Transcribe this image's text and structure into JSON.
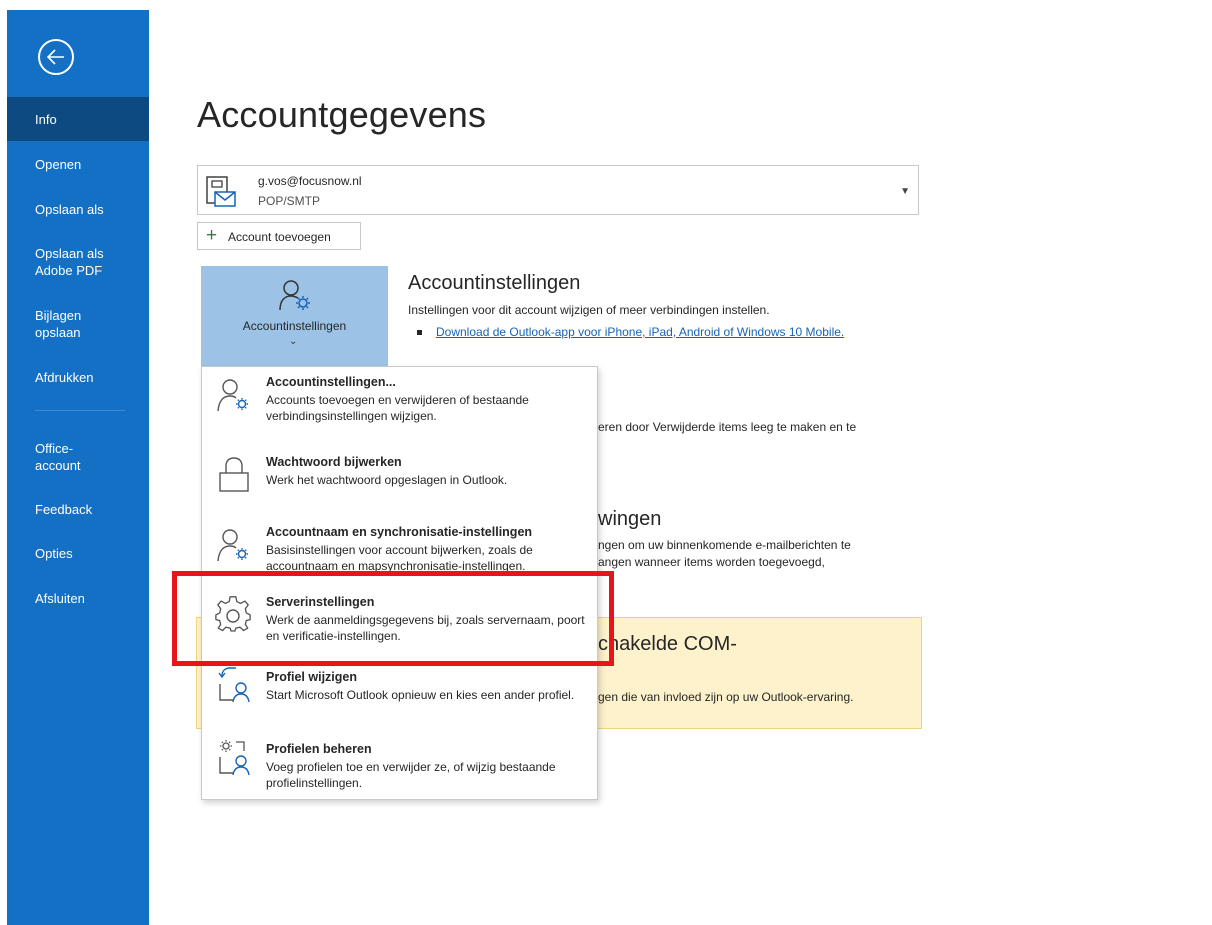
{
  "sidebar": {
    "items": [
      {
        "label": "Info"
      },
      {
        "label": "Openen"
      },
      {
        "label": "Opslaan als"
      },
      {
        "label": "Opslaan als Adobe PDF"
      },
      {
        "label": "Bijlagen opslaan"
      },
      {
        "label": "Afdrukken"
      },
      {
        "label": "Office-account"
      },
      {
        "label": "Feedback"
      },
      {
        "label": "Opties"
      },
      {
        "label": "Afsluiten"
      }
    ]
  },
  "main": {
    "title": "Accountgegevens",
    "account": {
      "email": "g.vos@focusnow.nl",
      "type": "POP/SMTP"
    },
    "add_account_label": "Account toevoegen",
    "settings_button_label": "Accountinstellingen",
    "sections": {
      "account_settings": {
        "title": "Accountinstellingen",
        "description": "Instellingen voor dit account wijzigen of meer verbindingen instellen.",
        "link": "Download de Outlook-app voor iPhone, iPad, Android of Windows 10 Mobile."
      },
      "cleanup": {
        "line1": "eren door Verwijderde items leeg te maken en te"
      },
      "rules": {
        "title_fragment": "wingen",
        "line1": "ngen om uw binnenkomende e-mailberichten te",
        "line2": "angen wanneer items worden toegevoegd,"
      },
      "com": {
        "title_fragment": "chakelde COM-",
        "line1": "gen die van invloed zijn op uw Outlook-ervaring."
      }
    }
  },
  "menu": {
    "items": [
      {
        "title": "Accountinstellingen...",
        "description": "Accounts toevoegen en verwijderen of bestaande verbindingsinstellingen wijzigen."
      },
      {
        "title": "Wachtwoord bijwerken",
        "description": "Werk het wachtwoord opgeslagen in Outlook."
      },
      {
        "title": "Accountnaam en synchronisatie-instellingen",
        "description": "Basisinstellingen voor account bijwerken, zoals de accountnaam en mapsynchronisatie-instellingen."
      },
      {
        "title": "Serverinstellingen",
        "description": "Werk de aanmeldingsgegevens bij, zoals servernaam, poort en verificatie-instellingen."
      },
      {
        "title": "Profiel wijzigen",
        "description": "Start  Microsoft Outlook opnieuw en kies een ander profiel."
      },
      {
        "title": "Profielen beheren",
        "description": "Voeg profielen toe en verwijder ze, of wijzig bestaande profielinstellingen."
      }
    ]
  },
  "colors": {
    "sidebar": "#1370c4",
    "sidebar_active": "#0d4a82",
    "highlight": "#e8141b",
    "settings_button": "#9cc3e5"
  }
}
